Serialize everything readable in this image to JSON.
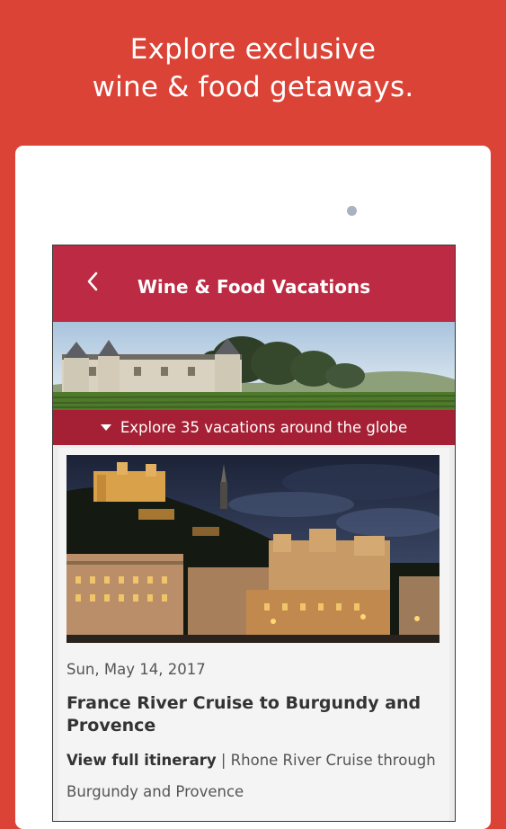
{
  "promo": {
    "line1": "Explore exclusive",
    "line2": "wine & food getaways."
  },
  "app": {
    "title": "Wine & Food Vacations",
    "back_icon": "chevron-left-icon",
    "accent_color": "#bd2a43",
    "explore_text": "Explore 35 vacations around the globe"
  },
  "card": {
    "date": "Sun, May 14, 2017",
    "title": "France River Cruise to Burgundy and Provence",
    "itinerary_link": "View full itinerary",
    "separator": " | ",
    "subtitle": "Rhone River Cruise through Burgundy and Provence"
  }
}
